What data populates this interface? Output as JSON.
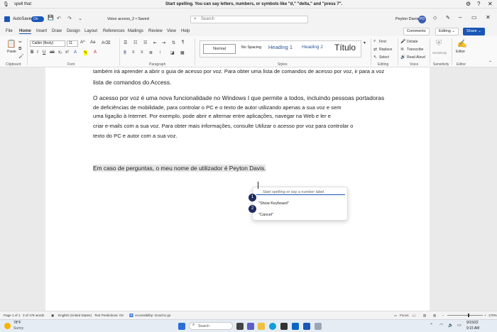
{
  "voice_bar": {
    "title": "spell that",
    "message": "Start spelling. You can say letters, numbers, or symbols like \"d,\" \"delta,\" and \"press 7\"."
  },
  "titlebar": {
    "autosave": "AutoSave",
    "autosave_state": "On",
    "doc_name": "Voice access_2 • Saved",
    "search_placeholder": "Search",
    "user": "Peyton Davis",
    "avatar": "PD"
  },
  "tabs": [
    "File",
    "Home",
    "Insert",
    "Draw",
    "Design",
    "Layout",
    "References",
    "Mailings",
    "Review",
    "View",
    "Help"
  ],
  "tab_buttons": {
    "comments": "Comments",
    "editing": "Editing",
    "share": "Share"
  },
  "ribbon": {
    "paste": "Paste",
    "font_name": "Calibri (Body)",
    "font_size": "11",
    "styles": [
      "Normal",
      "No Spacing",
      "Heading 1",
      "Heading 2",
      "Título"
    ],
    "find": "Find",
    "replace": "Replace",
    "select": "Select",
    "dictate": "Dictate",
    "transcribe": "Transcribe",
    "read_aloud": "Read Aloud",
    "sensitivity": "Sensitivity",
    "editor": "Editor",
    "groups": [
      "Clipboard",
      "Font",
      "Paragraph",
      "Styles",
      "Editing",
      "Voice",
      "Sensitivity",
      "Editor"
    ]
  },
  "document": {
    "p1": "também irá aprender a abrir o guia de acesso por voz. Para obter uma lista de comandos de acesso por voz, ir para a voz",
    "p1b": "lista de comandos do Access.",
    "p2_l1": "O acesso por voz é uma nova funcionalidade no Windows I que permite a todos, incluindo pessoas portadoras",
    "p2_l2": "de deficiências de mobilidade, para controlar o PC e o texto de autor utilizando apenas a sua voz e sem",
    "p2_l3": "uma ligação à Internet. Por exemplo, pode abrir e alternar entre aplicações, navegar na Web e ler e",
    "p2_l4": "criar e-mails com a sua voz. Para obter mais informações, consulte Utilizar o acesso por voz para controlar o",
    "p2_l5": "texto do PC e autor com a sua voz.",
    "p3": "Em caso de perguntas, o meu nome de utilizador é Peyton Davis."
  },
  "popup": {
    "placeholder": "Start spelling or say a number label",
    "items": [
      {
        "n": "1",
        "label": "\"Show Keyboard\""
      },
      {
        "n": "2",
        "label": "\"Cancel\""
      }
    ]
  },
  "status": {
    "page": "Page 1 of 1",
    "words": "3 of 176 words",
    "language": "English (United States)",
    "predictions": "Text Predictions: On",
    "accessibility": "Accessibility: Good to go",
    "focus": "Focus",
    "zoom": "170%"
  },
  "taskbar": {
    "temp": "78°F",
    "weather": "Sunny",
    "search": "Search",
    "time": "9:15 AM",
    "date": "9/15/22"
  },
  "colors": {
    "accent": "#1a56b6",
    "navy": "#1d2c5e"
  }
}
